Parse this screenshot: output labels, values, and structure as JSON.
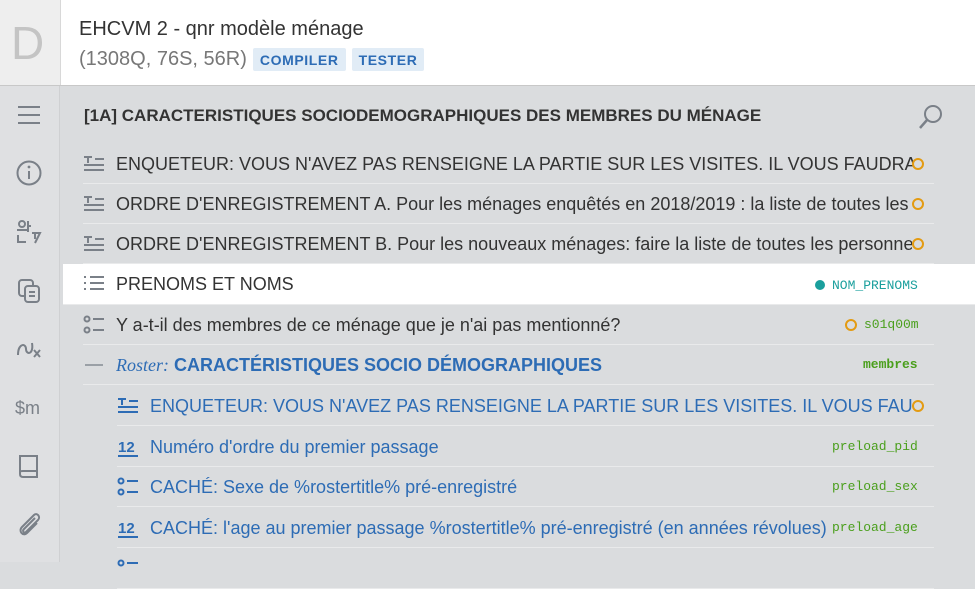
{
  "app": {
    "logo": "D",
    "title": "EHCVM 2 - qnr modèle ménage",
    "stats": "(1308Q, 76S, 56R)",
    "compile_label": "COMPILER",
    "test_label": "TESTER"
  },
  "sidebar": {
    "items": [
      {
        "icon": "menu-icon"
      },
      {
        "icon": "info-icon"
      },
      {
        "icon": "translation-icon"
      },
      {
        "icon": "copy-icon"
      },
      {
        "icon": "macros-icon"
      },
      {
        "icon": "lookup-tables-icon"
      },
      {
        "icon": "book-icon"
      },
      {
        "icon": "attachment-icon"
      }
    ]
  },
  "section": {
    "title": "[1A] CARACTERISTIQUES SOCIODEMOGRAPHIQUES DES MEMBRES DU MÉNAGE"
  },
  "rows": [
    {
      "type": "static-text",
      "text": "ENQUETEUR: VOUS N'AVEZ PAS RENSEIGNE LA PARTIE SUR LES VISITES. IL VOUS FAUDRA",
      "var": "",
      "status": "warning"
    },
    {
      "type": "static-text",
      "text": "ORDRE D'ENREGISTREMENT A. Pour les ménages enquêtés en 2018/2019 : la liste de toutes les",
      "var": "",
      "status": "warning"
    },
    {
      "type": "static-text",
      "text": "ORDRE D'ENREGISTREMENT B. Pour les nouveaux ménages: faire la liste de toutes les personnes",
      "var": "",
      "status": "warning"
    },
    {
      "type": "list",
      "text": "PRENOMS ET NOMS",
      "var": "NOM_PRENOMS",
      "status": "ok"
    },
    {
      "type": "single-option",
      "text": "Y a-t-il des membres de ce ménage que je n'ai pas mentionné?",
      "var": "s01q00m",
      "status": "warning"
    },
    {
      "type": "roster",
      "label": "Roster:",
      "text": "CARACTÉRISTIQUES SOCIO DÉMOGRAPHIQUES",
      "var": "membres"
    },
    {
      "type": "static-text",
      "text": "ENQUETEUR: VOUS N'AVEZ PAS RENSEIGNE LA PARTIE SUR LES VISITES. IL VOUS FAUDRA",
      "var": "",
      "status": "warning"
    },
    {
      "type": "numeric",
      "text": "Numéro d'ordre du premier passage",
      "var": "preload_pid"
    },
    {
      "type": "single-option",
      "text": "CACHÉ: Sexe de %rostertitle% pré-enregistré",
      "var": "preload_sex"
    },
    {
      "type": "numeric",
      "text": "CACHÉ: l'age au premier passage %rostertitle% pré-enregistré (en années révolues)",
      "var": "preload_age"
    }
  ],
  "colors": {
    "accent": "#2d6cb5",
    "var_green": "#4a9f1c",
    "var_teal": "#1a9f9d",
    "warning": "#e39b12"
  }
}
